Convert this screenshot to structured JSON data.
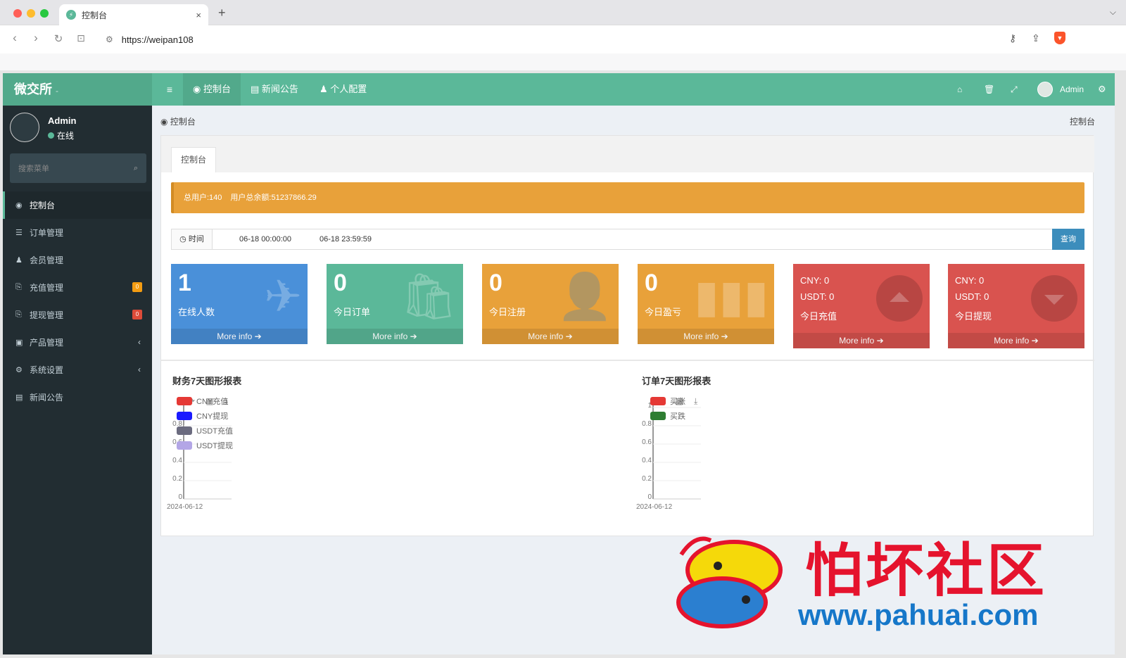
{
  "browser": {
    "tab_title": "控制台",
    "favicon": "shield-icon",
    "close": "×",
    "new_tab": "+",
    "tab_menu": "⌵",
    "url": "https://weipan108",
    "nav": {
      "back": "‹",
      "forward": "›",
      "reload": "↻",
      "bookmark": "⊡"
    },
    "icons": {
      "site_settings": "⚙",
      "key": "⚷",
      "share": "⇪",
      "brave": "▼"
    }
  },
  "app": {
    "logo": "微交所",
    "logo_suffix": "-",
    "menu_toggle": "≡",
    "top_nav": [
      {
        "icon": "dashboard-icon",
        "glyph": "◉",
        "label": "控制台"
      },
      {
        "icon": "newspaper-icon",
        "glyph": "▤",
        "label": "新闻公告"
      },
      {
        "icon": "user-icon",
        "glyph": "♟",
        "label": "个人配置"
      }
    ],
    "top_icons": {
      "home": "⌂",
      "trash": "🗑",
      "fullscreen": "⤢",
      "settings": "⚙"
    },
    "user_name": "Admin"
  },
  "sidebar": {
    "user_name": "Admin",
    "status": "在线",
    "search_placeholder": "搜索菜单",
    "search_icon": "⌕",
    "items": [
      {
        "label": "控制台",
        "glyph": "◉",
        "active": true
      },
      {
        "label": "订单管理",
        "glyph": "☰"
      },
      {
        "label": "会员管理",
        "glyph": "♟"
      },
      {
        "label": "充值管理",
        "glyph": "⎘",
        "badge": "0",
        "badge_color": "#f39c12"
      },
      {
        "label": "提现管理",
        "glyph": "⎘",
        "badge": "0",
        "badge_color": "#dd4b39"
      },
      {
        "label": "产品管理",
        "glyph": "▣",
        "chevron": "‹"
      },
      {
        "label": "系统设置",
        "glyph": "⚙",
        "chevron": "‹"
      },
      {
        "label": "新闻公告",
        "glyph": "▤"
      }
    ]
  },
  "breadcrumb": {
    "icon": "◉",
    "left": "控制台",
    "right": "控制台"
  },
  "panel": {
    "tab": "控制台",
    "alert": {
      "total_users": "总用户:140",
      "total_balance": "用户总余额:51237866.29"
    },
    "filter": {
      "label": "时间",
      "label_icon": "◷",
      "start": "06-18 00:00:00",
      "end": "06-18 23:59:59",
      "button": "查询"
    },
    "boxes": [
      {
        "value": "1",
        "label": "在线人数",
        "footer": "More info ➔",
        "color": "#4a90d9",
        "icon": "✈"
      },
      {
        "value": "0",
        "label": "今日订单",
        "footer": "More info ➔",
        "color": "#5bb899",
        "icon": "🛍"
      },
      {
        "value": "0",
        "label": "今日注册",
        "footer": "More info ➔",
        "color": "#e8a13a",
        "icon": "👤"
      },
      {
        "value": "0",
        "label": "今日盈亏",
        "footer": "More info ➔",
        "color": "#e8a13a",
        "icon": "▮"
      },
      {
        "cny": "CNY:  0",
        "usdt": "USDT:  0",
        "label": "今日充值",
        "footer": "More info ➔",
        "color": "#d9534f"
      },
      {
        "cny": "CNY:  0",
        "usdt": "USDT:  0",
        "label": "今日提现",
        "footer": "More info ➔",
        "color": "#d9534f"
      }
    ]
  },
  "charts_meta": {
    "toolbar": "⟳ ▦ ⤓"
  },
  "chart_data": [
    {
      "type": "line",
      "title": "财务7天图形报表",
      "x": [
        "2024-06-12"
      ],
      "y_ticks": [
        "0",
        "0.2",
        "0.4",
        "0.6",
        "0.8"
      ],
      "series": [
        {
          "name": "CNY充值",
          "color": "#e53935",
          "values": [
            0
          ]
        },
        {
          "name": "CNY提现",
          "color": "#1a1aff",
          "values": [
            0
          ]
        },
        {
          "name": "USDT充值",
          "color": "#6b6b7f",
          "values": [
            0
          ]
        },
        {
          "name": "USDT提现",
          "color": "#b3a6e6",
          "values": [
            0
          ]
        }
      ]
    },
    {
      "type": "line",
      "title": "订单7天图形报表",
      "x": [
        "2024-06-12"
      ],
      "y_ticks": [
        "0",
        "0.2",
        "0.4",
        "0.6",
        "0.8",
        "1"
      ],
      "series": [
        {
          "name": "买涨",
          "color": "#e53935",
          "values": [
            0
          ]
        },
        {
          "name": "买跌",
          "color": "#2e7d32",
          "values": [
            0
          ]
        }
      ]
    }
  ],
  "watermark": {
    "text": "怕坏社区",
    "url": "www.pahuai.com"
  }
}
